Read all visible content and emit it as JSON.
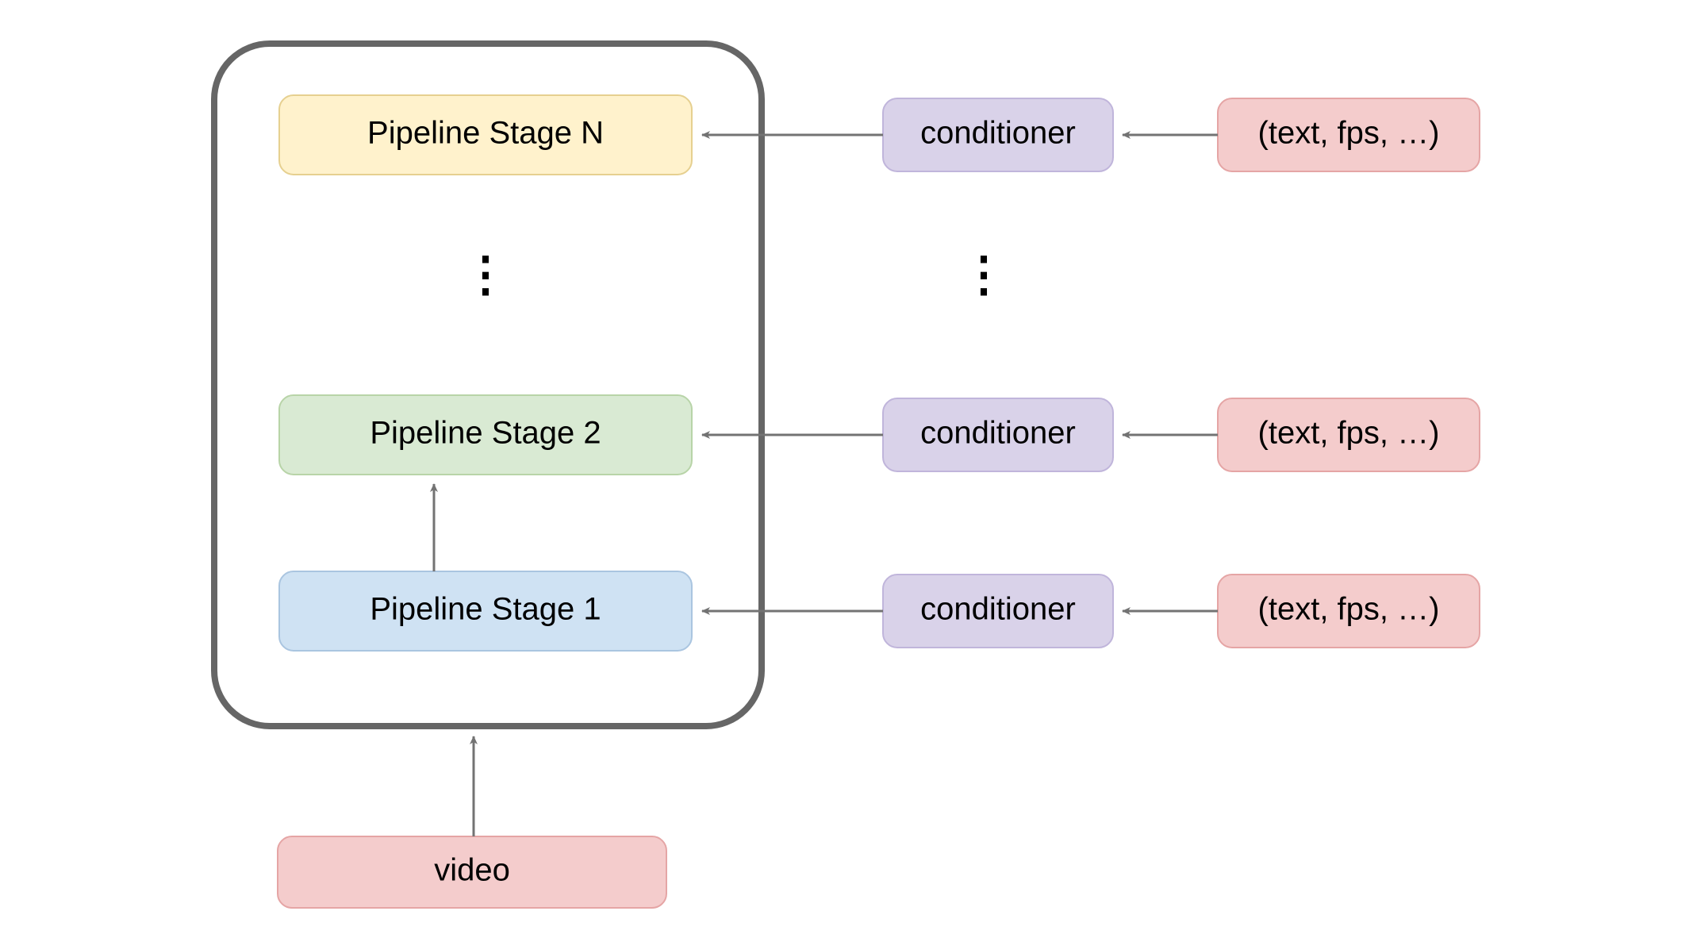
{
  "stages": {
    "stageN": {
      "label": "Pipeline Stage N"
    },
    "stage2": {
      "label": "Pipeline Stage 2"
    },
    "stage1": {
      "label": "Pipeline Stage 1"
    }
  },
  "conditioners": {
    "c1": {
      "label": "conditioner"
    },
    "c2": {
      "label": "conditioner"
    },
    "cN": {
      "label": "conditioner"
    }
  },
  "inputs": {
    "i1": {
      "label": "(text, fps, …)"
    },
    "i2": {
      "label": "(text, fps, …)"
    },
    "iN": {
      "label": "(text, fps, …)"
    }
  },
  "video": {
    "label": "video"
  },
  "ellipsis": {
    "left": "⋮",
    "right": "⋮"
  },
  "colors": {
    "pink_fill": "#f4cccc",
    "pink_stroke": "#e5a5a5",
    "yellow_fill": "#fff2cc",
    "yellow_stroke": "#e6d090",
    "green_fill": "#d9ead3",
    "green_stroke": "#b8d4a8",
    "blue_fill": "#cfe2f3",
    "blue_stroke": "#aac5e0",
    "purple_fill": "#d9d2e9",
    "purple_stroke": "#c0b5db",
    "box_stroke": "#666666",
    "arrow": "#737373"
  }
}
